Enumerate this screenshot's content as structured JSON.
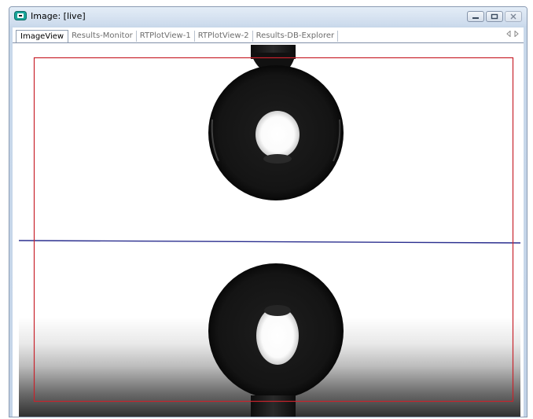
{
  "window": {
    "title": "Image: [live]"
  },
  "tabs": [
    {
      "label": "ImageView",
      "active": true
    },
    {
      "label": "Results-Monitor",
      "active": false
    },
    {
      "label": "RTPlotView-1",
      "active": false
    },
    {
      "label": "RTPlotView-2",
      "active": false
    },
    {
      "label": "Results-DB-Explorer",
      "active": false
    }
  ],
  "icons": {
    "app": "camera-icon",
    "minimize": "minimize-icon",
    "restore": "restore-icon",
    "close": "close-icon",
    "tab_left": "arrow-left-icon",
    "tab_right": "arrow-right-icon"
  },
  "colors": {
    "roi_box": "#c8232c",
    "baseline": "#2b2f8f",
    "droplet": "#111111"
  }
}
